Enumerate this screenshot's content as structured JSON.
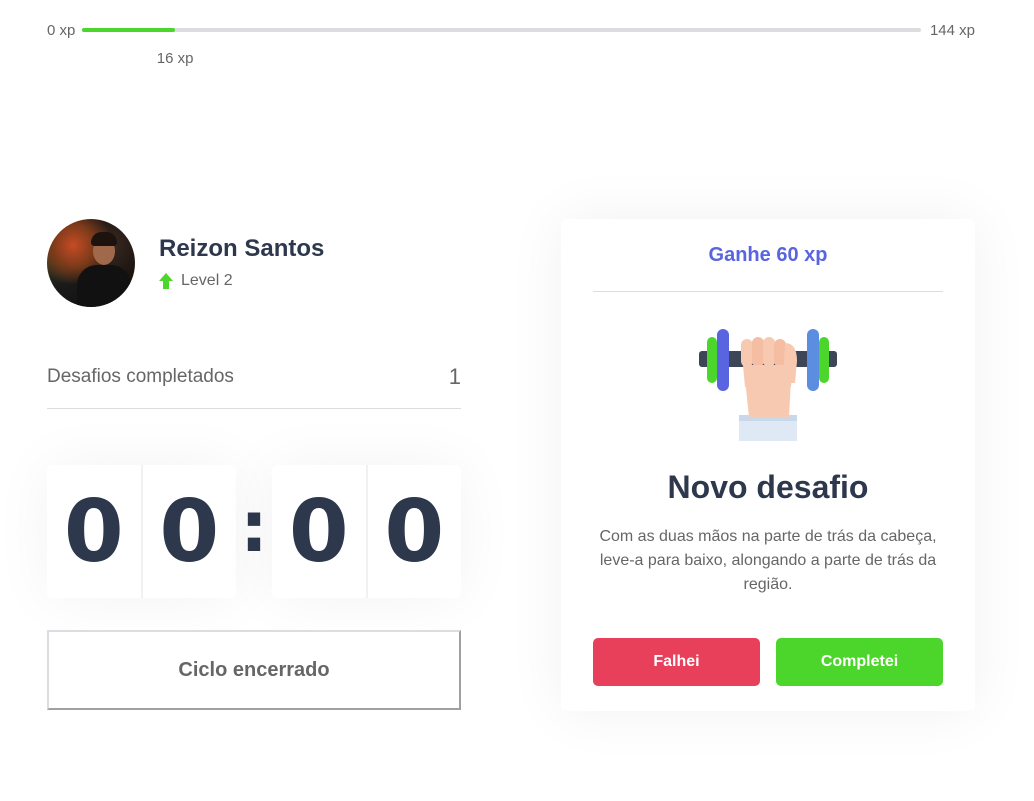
{
  "xp": {
    "min_label": "0 xp",
    "max_label": "144 xp",
    "current_label": "16 xp",
    "current": 16,
    "max": 144,
    "progress_fraction": 0.111,
    "fill_color": "#4cd62b"
  },
  "profile": {
    "name": "Reizon Santos",
    "level_label": "Level 2",
    "level_icon": "level-up-arrow-icon",
    "avatar": "profile-photo"
  },
  "completed": {
    "label": "Desafios completados",
    "count": "1"
  },
  "countdown": {
    "minute_left": "0",
    "minute_right": "0",
    "separator": ":",
    "second_left": "0",
    "second_right": "0"
  },
  "cycle_button": {
    "label": "Ciclo encerrado"
  },
  "challenge": {
    "reward": "Ganhe 60 xp",
    "icon": "dumbbell-icon",
    "title": "Novo desafio",
    "description": "Com as duas mãos na parte de trás da cabeça, leve-a para baixo, alongando a parte de trás da região.",
    "fail_label": "Falhei",
    "success_label": "Completei"
  },
  "colors": {
    "accent": "#5965e0",
    "title": "#2e384d",
    "text": "#666666",
    "green": "#4cd62b",
    "red": "#e83f5b"
  }
}
